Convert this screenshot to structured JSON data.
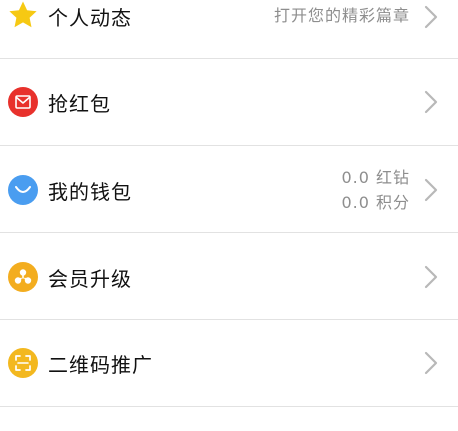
{
  "menu": {
    "items": [
      {
        "id": "personal-feed",
        "label": "个人动态",
        "sub": [
          "打开您的精彩篇章"
        ],
        "icon": "star-icon",
        "icon_color": "#f6c913"
      },
      {
        "id": "red-packet",
        "label": "抢红包",
        "sub": [],
        "icon": "red-envelope-icon",
        "icon_color": "#e8312c"
      },
      {
        "id": "wallet",
        "label": "我的钱包",
        "sub": [
          "0.0 红钻",
          "0.0 积分"
        ],
        "icon": "wallet-smile-icon",
        "icon_color": "#4a9df0"
      },
      {
        "id": "member-upgrade",
        "label": "会员升级",
        "sub": [],
        "icon": "member-icon",
        "icon_color": "#f3ad1f"
      },
      {
        "id": "qr-promo",
        "label": "二维码推广",
        "sub": [],
        "icon": "qr-scan-icon",
        "icon_color": "#f3b81f"
      }
    ]
  },
  "colors": {
    "divider": "#e2e2e2",
    "secondary_text": "#8e8e8e",
    "chevron": "#b8b8b8"
  }
}
